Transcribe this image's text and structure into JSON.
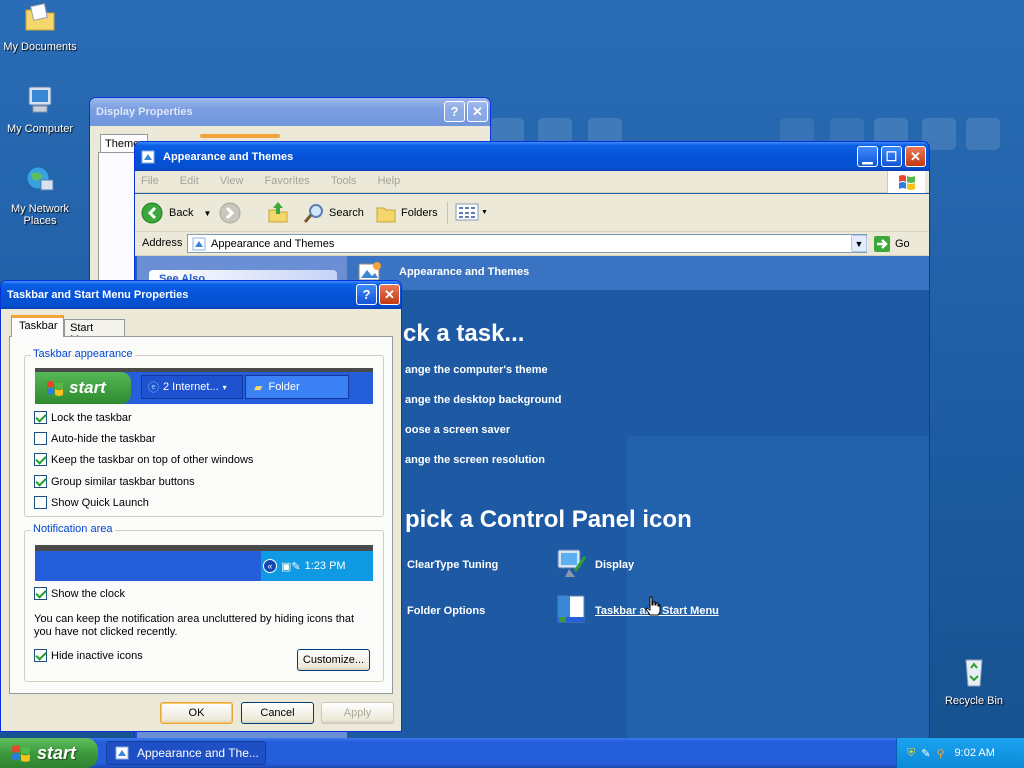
{
  "desktop": {
    "icons": [
      {
        "label": "My Documents"
      },
      {
        "label": "My Computer"
      },
      {
        "label": "My Network Places"
      },
      {
        "label": "Recycle Bin"
      }
    ]
  },
  "display_props": {
    "title": "Display Properties",
    "tab_partial": "Theme"
  },
  "explorer": {
    "title": "Appearance and Themes",
    "menu": [
      "File",
      "Edit",
      "View",
      "Favorites",
      "Tools",
      "Help"
    ],
    "toolbar": {
      "back": "Back",
      "search": "Search",
      "folders": "Folders"
    },
    "address_label": "Address",
    "address_value": "Appearance and Themes",
    "go_label": "Go",
    "see_also": "See Also",
    "header_title": "Appearance and Themes",
    "pick_task": "ck a task...",
    "tasks": [
      "ange the computer's theme",
      "ange the desktop background",
      "oose a screen saver",
      "ange the screen resolution"
    ],
    "pick_icon": "pick a Control Panel icon",
    "icons": [
      {
        "label": "ClearType Tuning"
      },
      {
        "label": "Display"
      },
      {
        "label": "Folder Options"
      },
      {
        "label": "Taskbar and Start Menu"
      }
    ]
  },
  "taskbar_props": {
    "title": "Taskbar and Start Menu Properties",
    "tabs": [
      "Taskbar",
      "Start Menu"
    ],
    "appearance_legend": "Taskbar appearance",
    "preview_start": "start",
    "preview_item1": "2 Internet...",
    "preview_item2": "Folder",
    "options": [
      {
        "label": "Lock the taskbar",
        "checked": true
      },
      {
        "label": "Auto-hide the taskbar",
        "checked": false
      },
      {
        "label": "Keep the taskbar on top of other windows",
        "checked": true
      },
      {
        "label": "Group similar taskbar buttons",
        "checked": true
      },
      {
        "label": "Show Quick Launch",
        "checked": false
      }
    ],
    "notification_legend": "Notification area",
    "preview_clock": "1:23 PM",
    "show_clock": {
      "label": "Show the clock",
      "checked": true
    },
    "note": "You can keep the notification area uncluttered by hiding icons that you have not clicked recently.",
    "hide_inactive": {
      "label": "Hide inactive icons",
      "checked": true
    },
    "customize": "Customize...",
    "ok": "OK",
    "cancel": "Cancel",
    "apply": "Apply"
  },
  "taskbar": {
    "start": "start",
    "task_item": "Appearance and The...",
    "clock": "9:02 AM"
  },
  "colors": {
    "desktop": "#2a6db6",
    "title_active": "#0553d8",
    "panel_blue": "#1d5fa8",
    "taskbar": "#245edb",
    "start_green": "#3c9a3c"
  }
}
